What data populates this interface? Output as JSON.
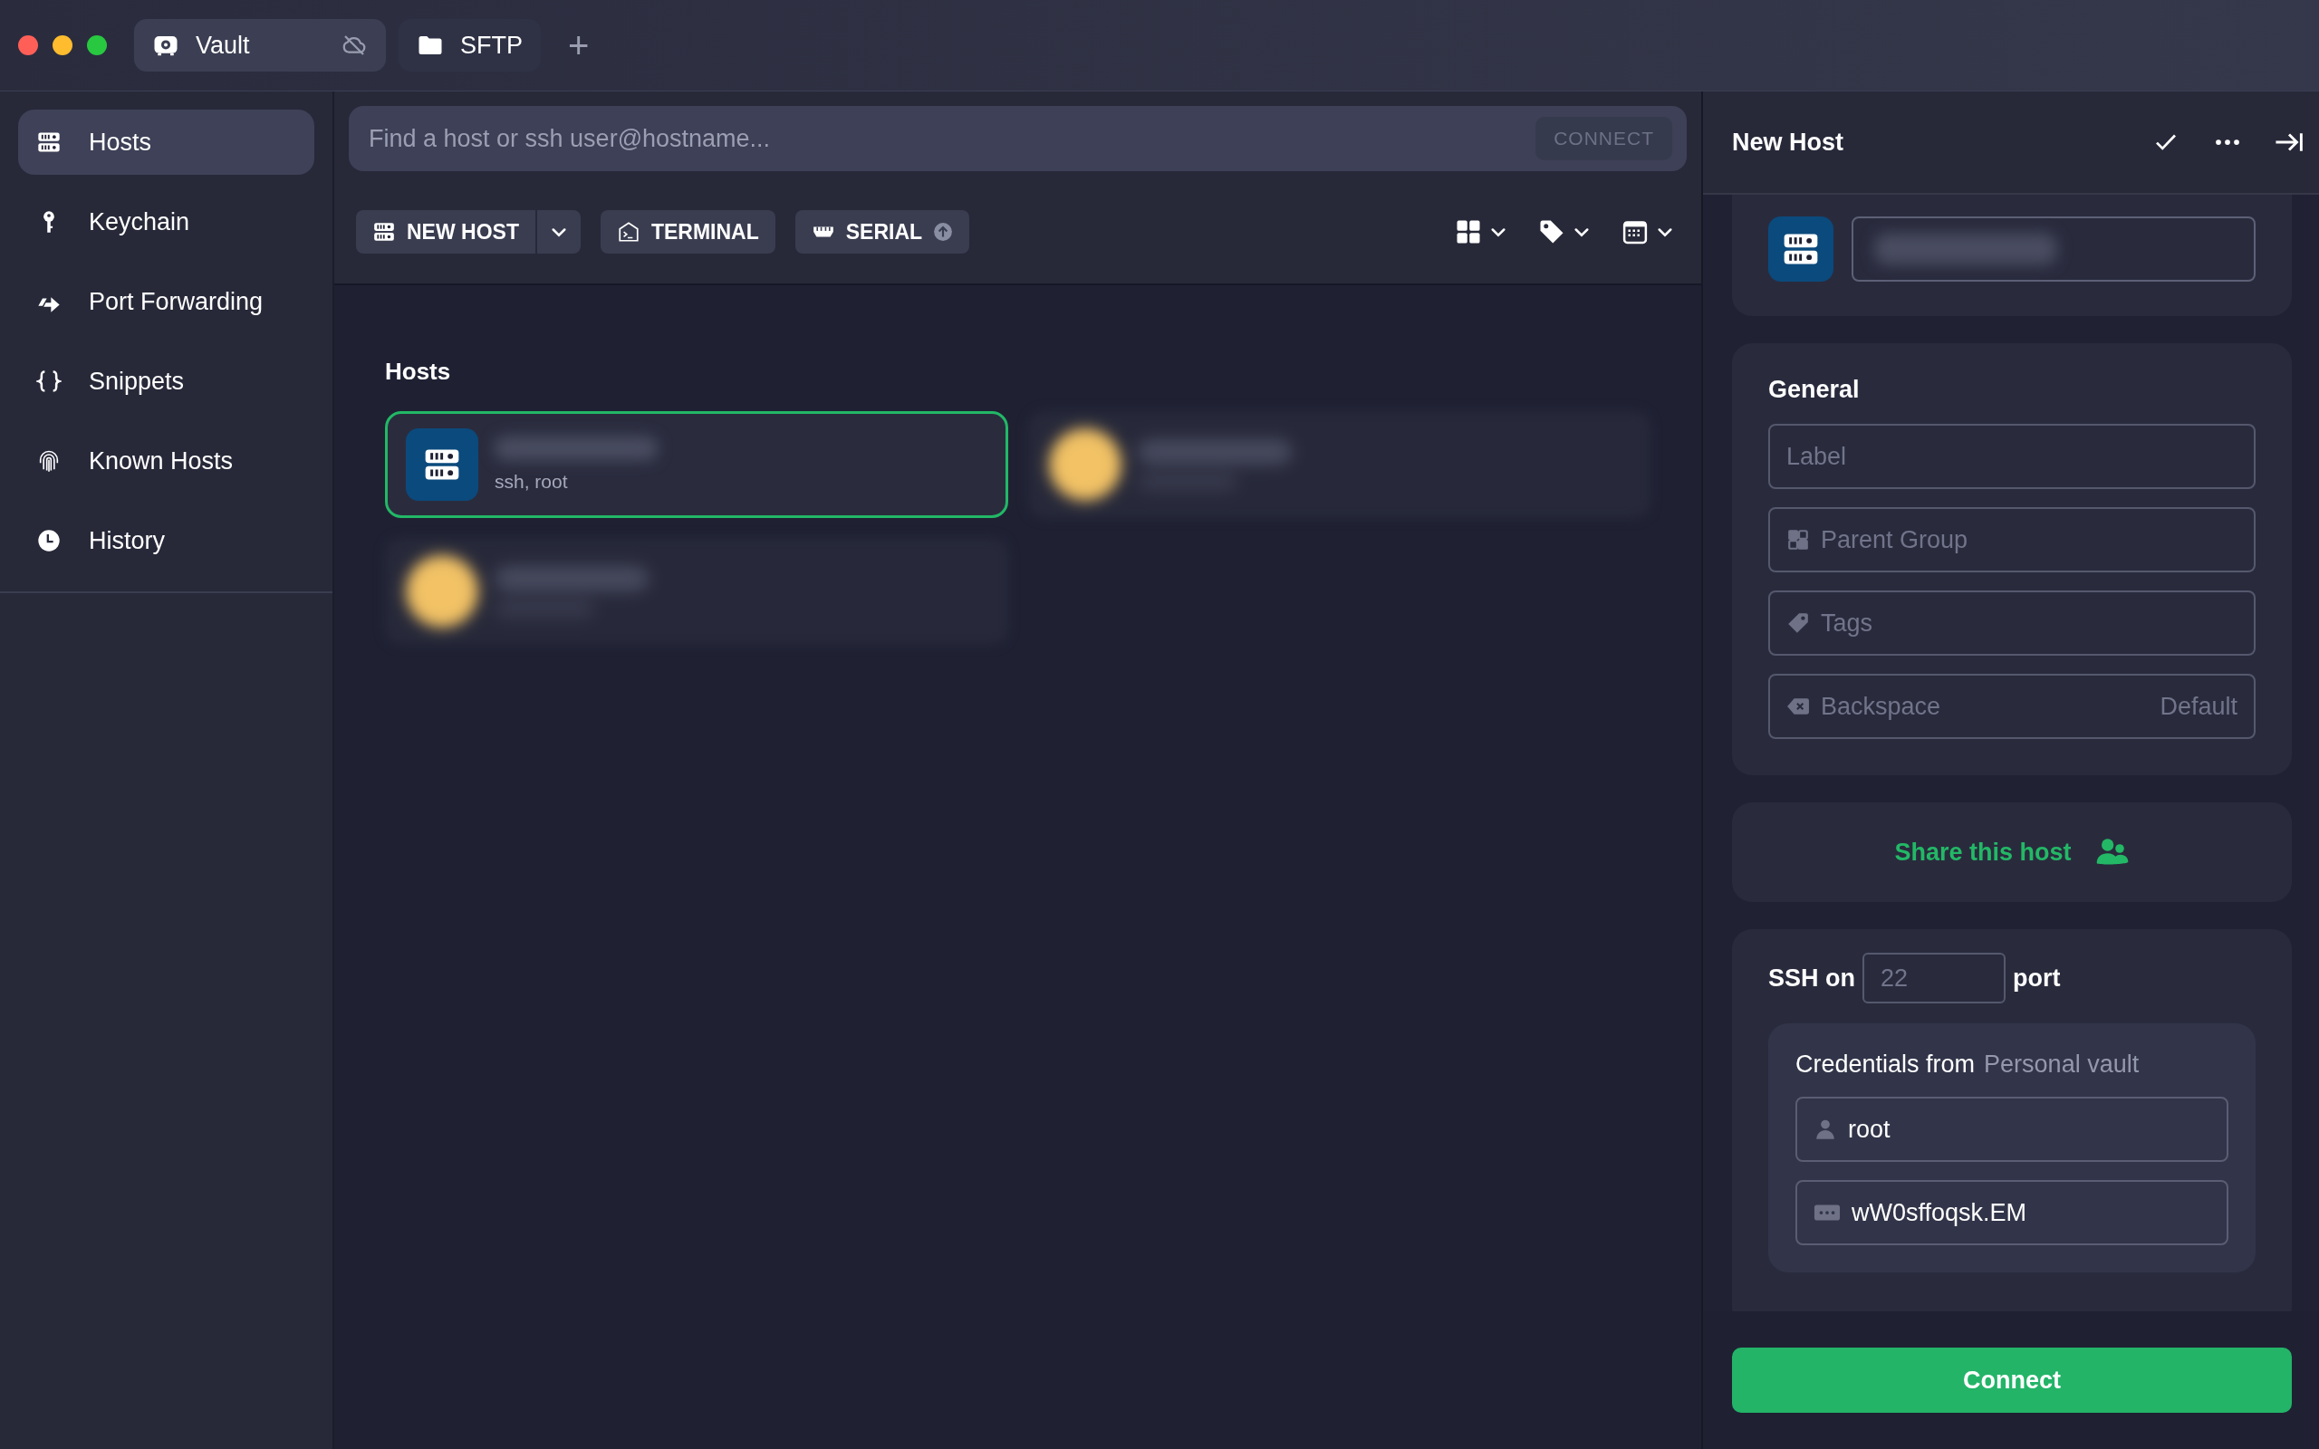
{
  "tabs": [
    {
      "label": "Vault",
      "kind": "vault",
      "selected": true,
      "cloud_off": true
    },
    {
      "label": "SFTP",
      "kind": "folder",
      "selected": false,
      "cloud_off": false
    }
  ],
  "new_tab": "+",
  "sidebar": {
    "items": [
      {
        "label": "Hosts",
        "kind": "hosts",
        "selected": true
      },
      {
        "label": "Keychain",
        "kind": "keychain",
        "selected": false
      },
      {
        "label": "Port Forwarding",
        "kind": "port-forwarding",
        "selected": false
      },
      {
        "label": "Snippets",
        "kind": "snippets",
        "selected": false
      },
      {
        "label": "Known Hosts",
        "kind": "known-hosts",
        "selected": false
      },
      {
        "label": "History",
        "kind": "history",
        "selected": false
      }
    ]
  },
  "search": {
    "placeholder": "Find a host or ssh user@hostname...",
    "button": "CONNECT",
    "disabled": true
  },
  "toolbar": {
    "buttons": [
      {
        "label": "NEW HOST",
        "kind": "new-host"
      },
      {
        "label": "TERMINAL",
        "kind": "terminal"
      },
      {
        "label": "SERIAL",
        "kind": "serial"
      }
    ]
  },
  "hosts": {
    "title": "Hosts",
    "cards": [
      {
        "kind": "server",
        "subtitle": "ssh, root",
        "selected": true
      },
      {
        "kind": "blurred",
        "selected": false
      },
      {
        "kind": "blurred",
        "selected": false
      }
    ]
  },
  "panel": {
    "title": "New Host",
    "general": {
      "title": "General",
      "fields": [
        {
          "kind": "label",
          "placeholder": "Label"
        },
        {
          "kind": "group",
          "placeholder": "Parent Group"
        },
        {
          "kind": "tags",
          "placeholder": "Tags"
        },
        {
          "kind": "backspace",
          "placeholder": "Backspace",
          "trailing": "Default"
        }
      ]
    },
    "share": "Share this host",
    "ssh": {
      "prefix": "SSH on",
      "port_placeholder": "22",
      "suffix": "port",
      "credentials": {
        "label": "Credentials from",
        "source": "Personal vault",
        "username": "root",
        "password": "wW0sffoqsk.EM"
      }
    },
    "connect": "Connect"
  }
}
